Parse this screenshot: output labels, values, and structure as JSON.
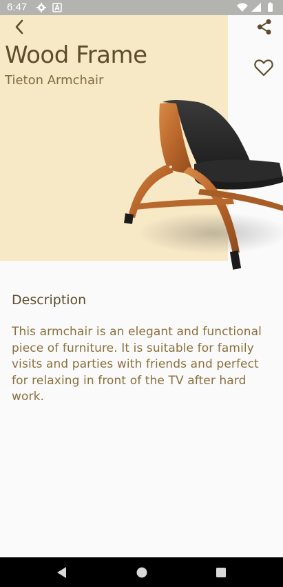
{
  "status_bar": {
    "time": "6:47",
    "left_icons": [
      "gear-icon",
      "a-icon"
    ],
    "right_icons": [
      "wifi-icon",
      "signal-icon",
      "battery-icon"
    ]
  },
  "header": {
    "back_icon": "chevron-left-icon",
    "share_icon": "share-icon",
    "favorite_icon": "heart-outline-icon"
  },
  "product": {
    "title": "Wood Frame",
    "subtitle": "Tieton Armchair",
    "image_alt": "Armchair with wooden frame and black cushioned seat"
  },
  "description": {
    "heading": "Description",
    "body": "This armchair is an elegant and functional piece of furniture. It is suitable for family visits and parties with friends and perfect for relaxing in front of the TV after hard work."
  },
  "nav_bar": {
    "icons": [
      "back-triangle-icon",
      "home-circle-icon",
      "recents-square-icon"
    ]
  },
  "colors": {
    "hero_background": "#f7e8c6",
    "title": "#5e4d2c",
    "subtitle": "#7f6c40",
    "body_text": "#8b6f3c",
    "page_background": "#fafafa",
    "status_bar": "#b3b3b0",
    "nav_bar": "#000000"
  }
}
